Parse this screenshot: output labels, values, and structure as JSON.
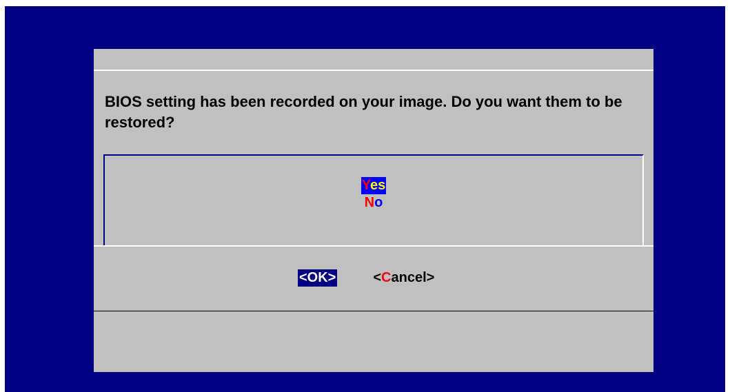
{
  "dialog": {
    "message": "BIOS setting has been recorded on your image. Do you want them to be restored?",
    "options": [
      {
        "hotkey": "Y",
        "rest": "es",
        "selected": true
      },
      {
        "hotkey": "N",
        "rest": "o",
        "selected": false
      }
    ],
    "buttons": {
      "ok_label": "<OK>",
      "cancel_prefix": "<",
      "cancel_hotkey": "C",
      "cancel_rest": "ancel>"
    }
  },
  "colors": {
    "background": "#000080",
    "dialog": "#c0c0c0",
    "selection": "#0000ff",
    "selected_text": "#ffff00",
    "hotkey": "#ff0000",
    "option_text": "#0000ff",
    "focused_button": "#000080"
  }
}
